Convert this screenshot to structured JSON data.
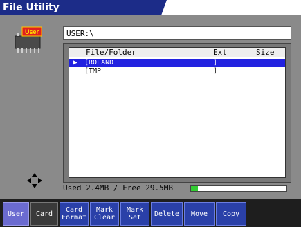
{
  "window": {
    "title": "File Utility"
  },
  "chip": {
    "label": "User"
  },
  "path": {
    "value": "USER:\\"
  },
  "list": {
    "headers": {
      "name": "File/Folder",
      "ext": "Ext",
      "size": "Size"
    },
    "rows": [
      {
        "mark": "▶",
        "name": "[ROLAND",
        "ext": "]",
        "selected": true
      },
      {
        "mark": "",
        "name": "[TMP",
        "ext": "]",
        "selected": false
      }
    ]
  },
  "status": {
    "text": "Used 2.4MB / Free 29.5MB",
    "used_fraction": 0.075
  },
  "colors": {
    "accent": "#2a40a8",
    "title": "#1c2c88",
    "selection": "#2222e0",
    "meter": "#33cc33"
  },
  "tabs": [
    {
      "label": "User",
      "active": true
    },
    {
      "label": "Card",
      "active": false
    }
  ],
  "buttons": [
    {
      "label": "Card\nFormat"
    },
    {
      "label": "Mark\nClear"
    },
    {
      "label": "Mark\nSet"
    },
    {
      "label": "Delete"
    },
    {
      "label": "Move"
    },
    {
      "label": "Copy"
    }
  ]
}
